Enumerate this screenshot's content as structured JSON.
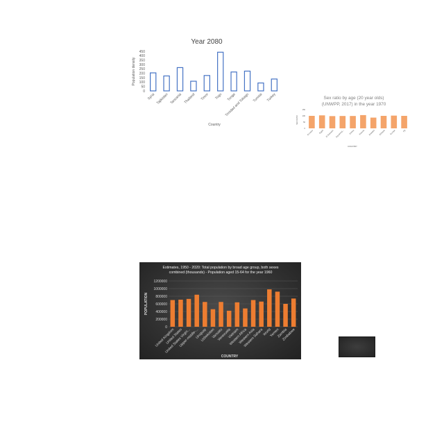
{
  "charts": [
    {
      "type": "bar",
      "title": "Year 2080",
      "xlabel": "Country",
      "ylabel": "Population density",
      "ylim": [
        0,
        450
      ],
      "yticks": [
        0,
        50,
        100,
        150,
        200,
        250,
        300,
        350,
        400,
        450
      ],
      "categories": [
        "Syria",
        "Tajikistan",
        "Tanzania",
        "Thailand",
        "Timor",
        "Togo",
        "Tonga",
        "Trinidad and Tobago",
        "Tunisia",
        "Turkey"
      ],
      "values": [
        205,
        170,
        265,
        110,
        175,
        440,
        215,
        225,
        90,
        135
      ],
      "colors": {
        "bar_stroke": "#4472c4",
        "bar_fill": "#ffffff",
        "text": "#595959",
        "title": "#404040"
      }
    },
    {
      "type": "bar",
      "title": "Sex ratio by age (20 year olds) (UNWPP, 2017) in the year 1970",
      "title_lines": [
        "Sex ratio by age (20 year olds)",
        "(UNWPP, 2017) in the year 1970"
      ],
      "xlabel": "COUNTRY",
      "ylabel": "SEX RATIO",
      "ylim": [
        0,
        150
      ],
      "yticks": [
        0,
        50,
        100,
        150
      ],
      "categories": [
        "Ecuador",
        "Egypt",
        "El Salvador",
        "Equatorial...",
        "Eritrea",
        "Estonia",
        "Eswatini",
        "Ethiopia",
        "Europe",
        "Fiji"
      ],
      "values": [
        100,
        104,
        98,
        99,
        99,
        106,
        86,
        100,
        102,
        100
      ],
      "colors": {
        "bar_fill": "#f4a46a",
        "text": "#595959"
      }
    },
    {
      "type": "bar",
      "title": "Estimates, 1950 - 2020: Total population by broad age group, both sexes combined (thousands) - Population aged 15-64 for the year 1960",
      "title_lines": [
        "Estimates, 1950 - 2020: Total population by broad age group, both sexes",
        "combined (thousands) - Population aged 15-64 for the year 1960"
      ],
      "xlabel": "COUNTRY",
      "ylabel": "POPULATION",
      "ylim": [
        0,
        1200000
      ],
      "yticks": [
        0,
        200000,
        400000,
        600000,
        800000,
        1000000,
        1200000
      ],
      "categories": [
        "United Kingdom",
        "United States",
        "United States Virgin...",
        "Upper-middle-...",
        "Uruguay",
        "Uzbekistan",
        "Vanuatu",
        "Venezuela",
        "Vietnam",
        "Western Africa",
        "Western Asia",
        "Western Sahara",
        "World",
        "Yemen",
        "Zambia",
        "Zimbabwe"
      ],
      "show_labels": [
        "United Kingdom",
        "United States",
        "United States Virgin...",
        "Upper-middle-...",
        "Uruguay",
        "Uzbekistan",
        "Vanuatu",
        "Venezuela",
        "Vietnam",
        "Western Africa",
        "Western Asia",
        "Western Sahara",
        "World",
        "Yemen",
        "Zambia",
        "Zimbabwe"
      ],
      "values": [
        700000,
        710000,
        730000,
        840000,
        650000,
        460000,
        650000,
        420000,
        640000,
        480000,
        700000,
        660000,
        980000,
        920000,
        600000,
        740000
      ],
      "colors": {
        "bar_fill": "#ed7d31",
        "text": "#d9d9d9",
        "title": "#f2f2f2",
        "grid": "#5a5a5a"
      }
    }
  ]
}
